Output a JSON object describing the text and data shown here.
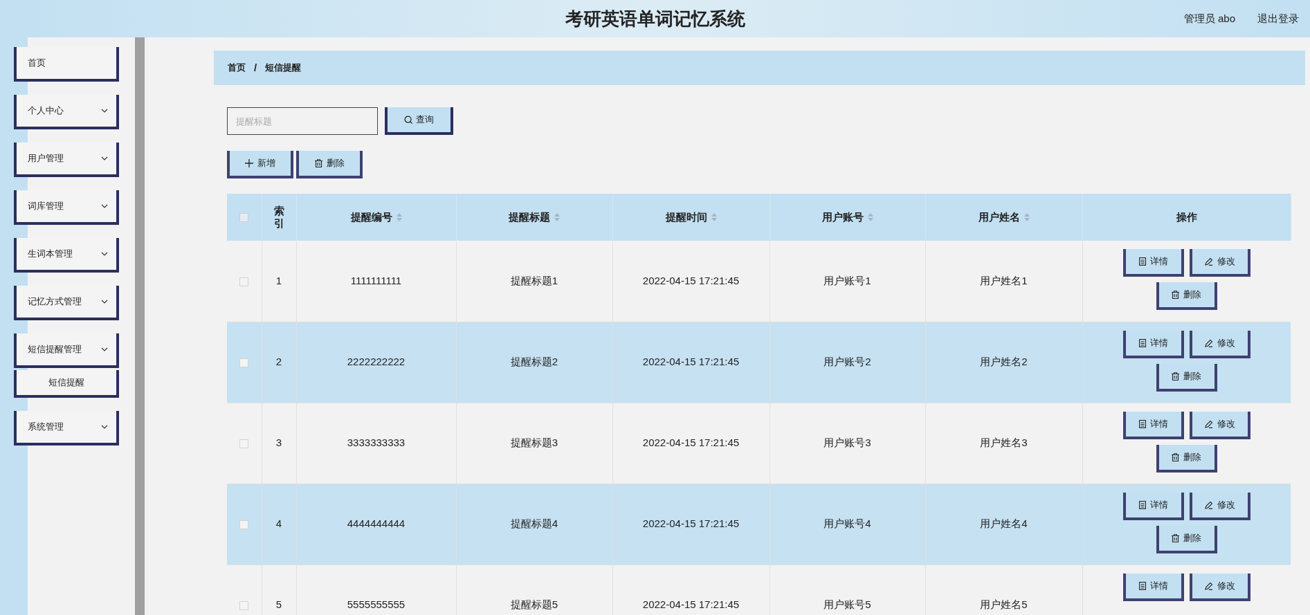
{
  "header": {
    "title": "考研英语单词记忆系统",
    "user": "管理员 abo",
    "logout": "退出登录"
  },
  "sidebar": {
    "items": [
      {
        "label": "首页",
        "expandable": false
      },
      {
        "label": "个人中心",
        "expandable": true
      },
      {
        "label": "用户管理",
        "expandable": true
      },
      {
        "label": "词库管理",
        "expandable": true
      },
      {
        "label": "生词本管理",
        "expandable": true
      },
      {
        "label": "记忆方式管理",
        "expandable": true
      },
      {
        "label": "短信提醒管理",
        "expandable": true,
        "children": [
          {
            "label": "短信提醒"
          }
        ]
      },
      {
        "label": "系统管理",
        "expandable": true
      }
    ]
  },
  "breadcrumb": {
    "items": [
      "首页",
      "短信提醒"
    ],
    "separator": "/"
  },
  "search": {
    "placeholder": "提醒标题",
    "button": "查询"
  },
  "toolbar": [
    {
      "kind": "add",
      "label": "新增"
    },
    {
      "kind": "delete",
      "label": "删除"
    }
  ],
  "table": {
    "select_all_checked": false,
    "columns": [
      {
        "label": "索引",
        "sortable": false
      },
      {
        "label": "提醒编号",
        "sortable": true
      },
      {
        "label": "提醒标题",
        "sortable": true
      },
      {
        "label": "提醒时间",
        "sortable": true
      },
      {
        "label": "用户账号",
        "sortable": true
      },
      {
        "label": "用户姓名",
        "sortable": true
      },
      {
        "label": "操作",
        "sortable": false
      }
    ],
    "rows": [
      {
        "checked": false,
        "cells": [
          "1",
          "1111111111",
          "提醒标题1",
          "2022-04-15 17:21:45",
          "用户账号1",
          "用户姓名1"
        ],
        "actions": [
          {
            "kind": "detail",
            "label": "详情"
          },
          {
            "kind": "edit",
            "label": "修改"
          },
          {
            "kind": "delete",
            "label": "删除"
          }
        ]
      },
      {
        "checked": false,
        "cells": [
          "2",
          "2222222222",
          "提醒标题2",
          "2022-04-15 17:21:45",
          "用户账号2",
          "用户姓名2"
        ],
        "actions": [
          {
            "kind": "detail",
            "label": "详情"
          },
          {
            "kind": "edit",
            "label": "修改"
          },
          {
            "kind": "delete",
            "label": "删除"
          }
        ]
      },
      {
        "checked": false,
        "cells": [
          "3",
          "3333333333",
          "提醒标题3",
          "2022-04-15 17:21:45",
          "用户账号3",
          "用户姓名3"
        ],
        "actions": [
          {
            "kind": "detail",
            "label": "详情"
          },
          {
            "kind": "edit",
            "label": "修改"
          },
          {
            "kind": "delete",
            "label": "删除"
          }
        ]
      },
      {
        "checked": false,
        "cells": [
          "4",
          "4444444444",
          "提醒标题4",
          "2022-04-15 17:21:45",
          "用户账号4",
          "用户姓名4"
        ],
        "actions": [
          {
            "kind": "detail",
            "label": "详情"
          },
          {
            "kind": "edit",
            "label": "修改"
          },
          {
            "kind": "delete",
            "label": "删除"
          }
        ]
      },
      {
        "checked": false,
        "cells": [
          "5",
          "5555555555",
          "提醒标题5",
          "2022-04-15 17:21:45",
          "用户账号5",
          "用户姓名5"
        ],
        "actions": [
          {
            "kind": "detail",
            "label": "详情"
          },
          {
            "kind": "edit",
            "label": "修改"
          }
        ]
      }
    ]
  }
}
